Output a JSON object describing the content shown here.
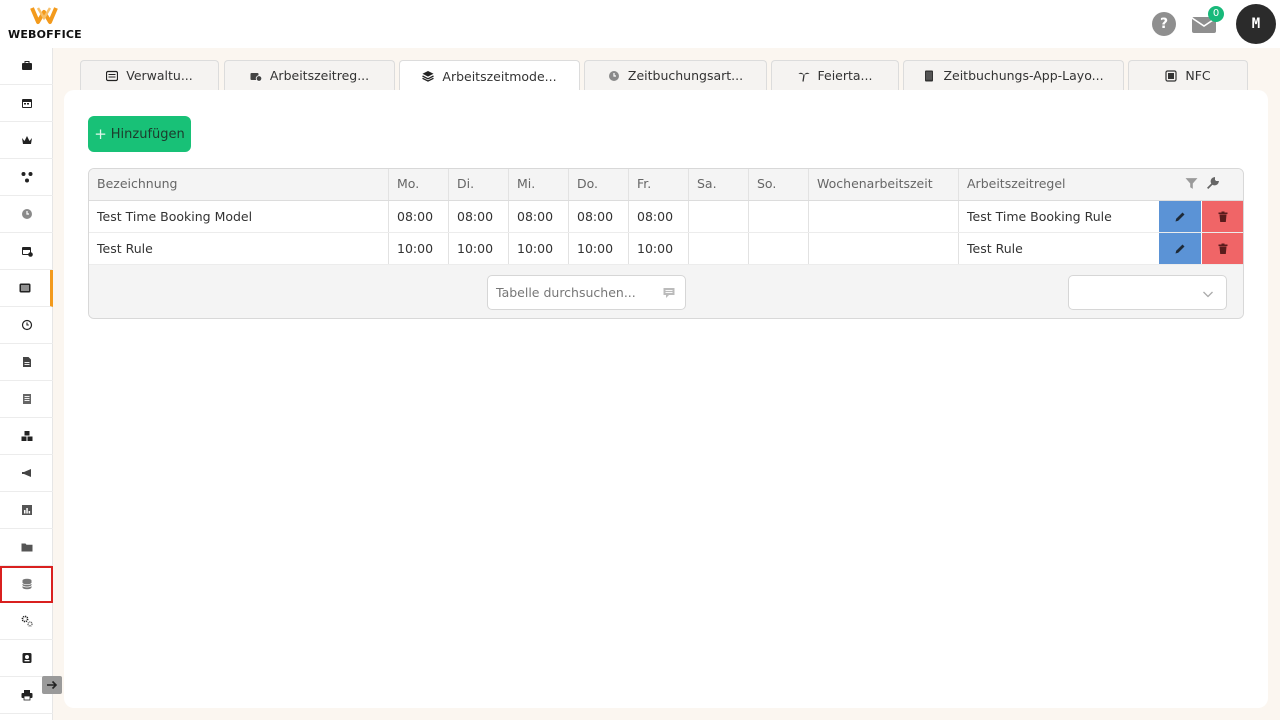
{
  "brand": {
    "name": "WEBOFFICE",
    "accent": "#f39a1c"
  },
  "header": {
    "help_label": "?",
    "mail_count": "0",
    "avatar_initial": "M"
  },
  "sidebar": {
    "items": [
      {
        "icon": "briefcase-icon"
      },
      {
        "icon": "calendar-icon"
      },
      {
        "icon": "crown-icon"
      },
      {
        "icon": "network-icon"
      },
      {
        "icon": "clock-icon"
      },
      {
        "icon": "calendar-user-icon"
      },
      {
        "icon": "list-alt-icon",
        "active": true
      },
      {
        "icon": "history-icon"
      },
      {
        "icon": "file-icon"
      },
      {
        "icon": "document-icon"
      },
      {
        "icon": "cubes-icon"
      },
      {
        "icon": "megaphone-icon"
      },
      {
        "icon": "bar-chart-icon"
      },
      {
        "icon": "folder-icon"
      },
      {
        "icon": "database-icon",
        "highlight": true
      },
      {
        "icon": "cogs-icon"
      },
      {
        "icon": "id-badge-icon"
      },
      {
        "icon": "printer-icon"
      }
    ]
  },
  "tabs": [
    {
      "label": "Verwaltu...",
      "icon": "list-icon"
    },
    {
      "label": "Arbeitszeitreg...",
      "icon": "briefcase-clock-icon"
    },
    {
      "label": "Arbeitszeitmode...",
      "icon": "layers-icon",
      "active": true
    },
    {
      "label": "Zeitbuchungsart...",
      "icon": "clock-icon"
    },
    {
      "label": "Feierta...",
      "icon": "palm-tree-icon"
    },
    {
      "label": "Zeitbuchungs-App-Layo...",
      "icon": "tablet-icon"
    },
    {
      "label": "NFC",
      "icon": "nfc-card-icon"
    }
  ],
  "toolbar": {
    "add_label": "Hinzufügen"
  },
  "table": {
    "columns": [
      "Bezeichnung",
      "Mo.",
      "Di.",
      "Mi.",
      "Do.",
      "Fr.",
      "Sa.",
      "So.",
      "Wochenarbeitszeit",
      "Arbeitszeitregel"
    ],
    "rows": [
      [
        "Test Time Booking Model",
        "08:00",
        "08:00",
        "08:00",
        "08:00",
        "08:00",
        "",
        "",
        "",
        "Test Time Booking Rule"
      ],
      [
        "Test Rule",
        "10:00",
        "10:00",
        "10:00",
        "10:00",
        "10:00",
        "",
        "",
        "",
        "Test Rule"
      ]
    ],
    "search_placeholder": "Tabelle durchsuchen...",
    "page_size_value": ""
  },
  "colors": {
    "add_button": "#18c177",
    "edit_button": "#5b93d6",
    "delete_button": "#f06567"
  }
}
